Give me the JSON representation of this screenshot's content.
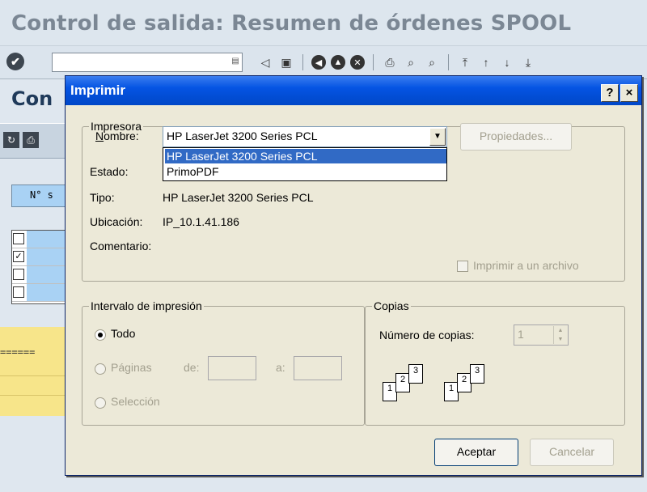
{
  "sap": {
    "window_title": "Control de salida: Resumen de órdenes SPOOL",
    "subtitle": "Con",
    "grid_header": "N° s",
    "dash_text": "======"
  },
  "dialog": {
    "title": "Imprimir",
    "help_label": "?",
    "close_label": "×",
    "printer_group": "Impresora",
    "name_label_u": "N",
    "name_label_rest": "ombre:",
    "selected_printer": "HP LaserJet 3200 Series PCL",
    "dropdown_options": [
      "HP LaserJet 3200 Series PCL",
      "PrimoPDF"
    ],
    "properties_button": "Propiedades...",
    "status_label": "Estado:",
    "type_label": "Tipo:",
    "type_value": "HP LaserJet 3200 Series PCL",
    "location_label": "Ubicación:",
    "location_value": "IP_10.1.41.186",
    "comment_label": "Comentario:",
    "print_to_file_label": "Imprimir a un archivo",
    "range_group": "Intervalo de impresión",
    "all_label": "Todo",
    "pages_label": "Páginas",
    "from_label": "de:",
    "to_label": "a:",
    "selection_label": "Selección",
    "copies_group": "Copias",
    "copies_label": "Número de copias:",
    "copies_value": "1",
    "ok_button": "Aceptar",
    "cancel_button": "Cancelar"
  },
  "colors": {
    "title_bar": "#0054e3",
    "dialog_bg": "#ece9d8",
    "selection": "#316ac5"
  }
}
